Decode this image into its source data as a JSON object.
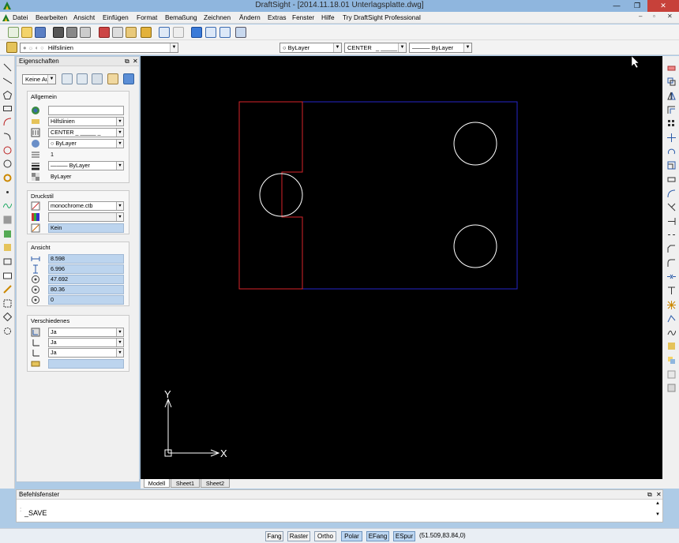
{
  "window": {
    "title": "DraftSight - [2014.11.18.01 Unterlagsplatte.dwg]",
    "minimize": "—",
    "restore": "❐",
    "close": "✕"
  },
  "menu": [
    "Datei",
    "Bearbeiten",
    "Ansicht",
    "Einfügen",
    "Format",
    "Bemaßung",
    "Zeichnen",
    "Ändern",
    "Extras",
    "Fenster",
    "Hilfe",
    "Try DraftSight Professional"
  ],
  "layer_toolbar": {
    "layer": "Hilfslinien",
    "color": "ByLayer",
    "linetype": "CENTER",
    "lineweight": "ByLayer"
  },
  "properties": {
    "title": "Eigenschaften",
    "filter": "Keine Aus",
    "general": {
      "title": "Allgemein",
      "rows": [
        {
          "icon": "color-wheel-icon",
          "value": ""
        },
        {
          "icon": "layer-icon",
          "value": "Hilfslinien"
        },
        {
          "icon": "linetype-icon",
          "value": "CENTER"
        },
        {
          "icon": "color-icon",
          "value": "ByLayer"
        },
        {
          "icon": "scale-icon",
          "value": "1"
        },
        {
          "icon": "lineweight-icon",
          "value": "ByLayer"
        },
        {
          "icon": "transparency-icon",
          "value": "ByLayer"
        }
      ]
    },
    "print_style": {
      "title": "Druckstil",
      "rows": [
        {
          "icon": "plotstyle-table-icon",
          "value": "monochrome.ctb"
        },
        {
          "icon": "plotstyle-icon",
          "value": ""
        },
        {
          "icon": "plotstyle-name-icon",
          "value": "Kein"
        }
      ]
    },
    "view": {
      "title": "Ansicht",
      "rows": [
        {
          "icon": "width-icon",
          "value": "8.598"
        },
        {
          "icon": "height-icon",
          "value": "6.996"
        },
        {
          "icon": "center-x-icon",
          "value": "47.692"
        },
        {
          "icon": "center-y-icon",
          "value": "80.36"
        },
        {
          "icon": "center-z-icon",
          "value": "0"
        }
      ]
    },
    "misc": {
      "title": "Verschiedenes",
      "rows": [
        {
          "icon": "ucs-icon",
          "value": "Ja"
        },
        {
          "icon": "ucs-origin-icon",
          "value": "Ja"
        },
        {
          "icon": "ucs-per-viewport-icon",
          "value": "Ja"
        },
        {
          "icon": "ucs-name-icon",
          "value": ""
        }
      ]
    }
  },
  "tabs": [
    "Modell",
    "Sheet1",
    "Sheet2"
  ],
  "ucs": {
    "x": "X",
    "y": "Y"
  },
  "command": {
    "title": "Befehlsfenster",
    "text": "_SAVE"
  },
  "status": {
    "buttons": [
      {
        "label": "Fang",
        "on": false
      },
      {
        "label": "Raster",
        "on": false
      },
      {
        "label": "Ortho",
        "on": false
      },
      {
        "label": "Polar",
        "on": true
      },
      {
        "label": "EFang",
        "on": true
      },
      {
        "label": "ESpur",
        "on": true
      }
    ],
    "coords": "(51.509,83.84,0)"
  },
  "colors": {
    "canvas": "#000000",
    "red_outline": "#d9252a",
    "blue_outline": "#2626c8",
    "circle": "#ffffff"
  }
}
